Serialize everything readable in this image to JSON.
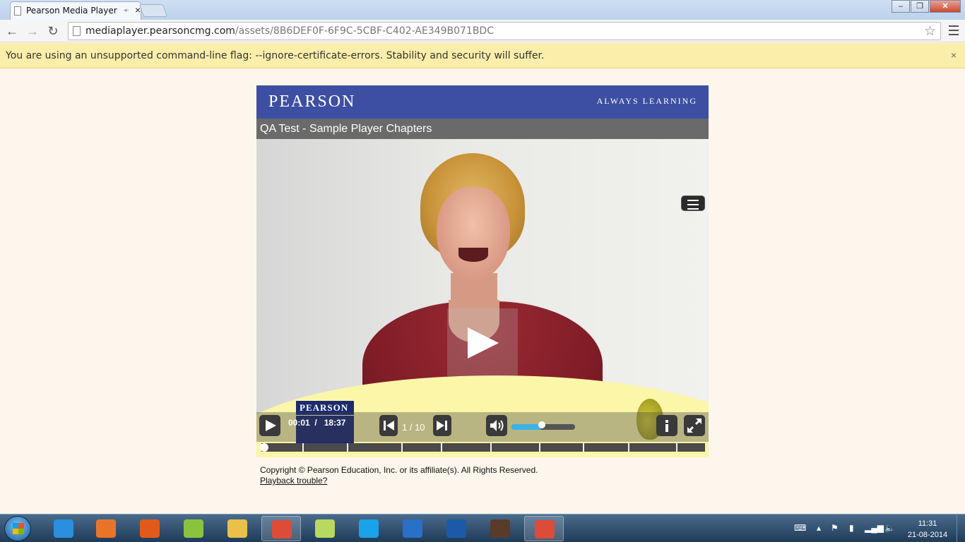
{
  "browser": {
    "tab_title": "Pearson Media Player",
    "url_host": "mediaplayer.pearsoncmg.com",
    "url_path": "/assets/8B6DEF0F-6F9C-5CBF-C402-AE349B071BDC",
    "infobar_message": "You are using an unsupported command-line flag: --ignore-certificate-errors. Stability and security will suffer."
  },
  "player": {
    "brand": "PEARSON",
    "tagline": "ALWAYS LEARNING",
    "title": "QA Test - Sample Player Chapters",
    "overlay_brand": "PEARSON",
    "current_time": "00:01",
    "time_separator": "/",
    "duration": "18:37",
    "chapter_counter": "1 / 10",
    "volume_level": 0.48,
    "progress_fraction": 0.001,
    "chapter_markers": 9
  },
  "footer": {
    "copyright": "Copyright © Pearson Education, Inc. or its affiliate(s). All Rights Reserved.",
    "playback_link": "Playback trouble?"
  },
  "taskbar": {
    "time": "11:31",
    "date": "21-08-2014",
    "apps": [
      {
        "name": "internet-explorer",
        "color": "#2a8fe0"
      },
      {
        "name": "media-player",
        "color": "#e8742a"
      },
      {
        "name": "firefox",
        "color": "#e05a1a"
      },
      {
        "name": "android-sdk",
        "color": "#8ac43f"
      },
      {
        "name": "file-explorer",
        "color": "#e8c04a"
      },
      {
        "name": "chrome",
        "color": "#dd4b39"
      },
      {
        "name": "notes",
        "color": "#b8d860"
      },
      {
        "name": "skype",
        "color": "#1aa3e8"
      },
      {
        "name": "lync",
        "color": "#2a6fc8"
      },
      {
        "name": "outlook",
        "color": "#1a5aa8"
      },
      {
        "name": "java-ee-ide",
        "color": "#5a3a2a"
      },
      {
        "name": "chrome",
        "color": "#dd4b39"
      }
    ]
  }
}
